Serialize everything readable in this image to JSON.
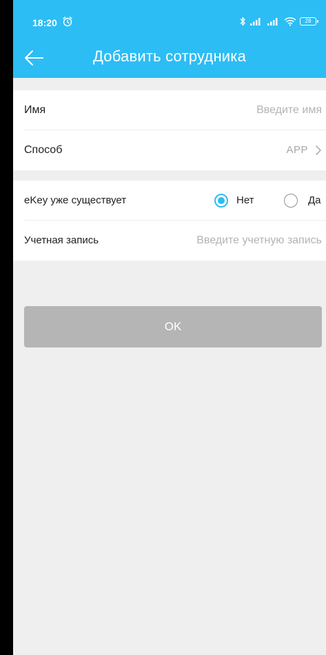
{
  "status_bar": {
    "time": "18:20",
    "battery": "28"
  },
  "header": {
    "title": "Добавить сотрудника"
  },
  "form": {
    "name": {
      "label": "Имя",
      "placeholder": "Введите имя"
    },
    "method": {
      "label": "Способ",
      "value": "APP"
    },
    "ekey_exists": {
      "label": "eKey уже существует",
      "options": [
        {
          "label": "Нет",
          "selected": true
        },
        {
          "label": "Да",
          "selected": false
        }
      ]
    },
    "account": {
      "label": "Учетная запись",
      "placeholder": "Введите учетную запись"
    }
  },
  "ok_button": {
    "label": "OK"
  },
  "colors": {
    "accent": "#2cbdf5",
    "button_disabled": "#b5b5b5",
    "background": "#efefef"
  },
  "icons": [
    "alarm-icon",
    "bluetooth-icon",
    "signal-icon",
    "wifi-icon",
    "battery-icon",
    "back-arrow-icon",
    "chevron-right-icon"
  ]
}
